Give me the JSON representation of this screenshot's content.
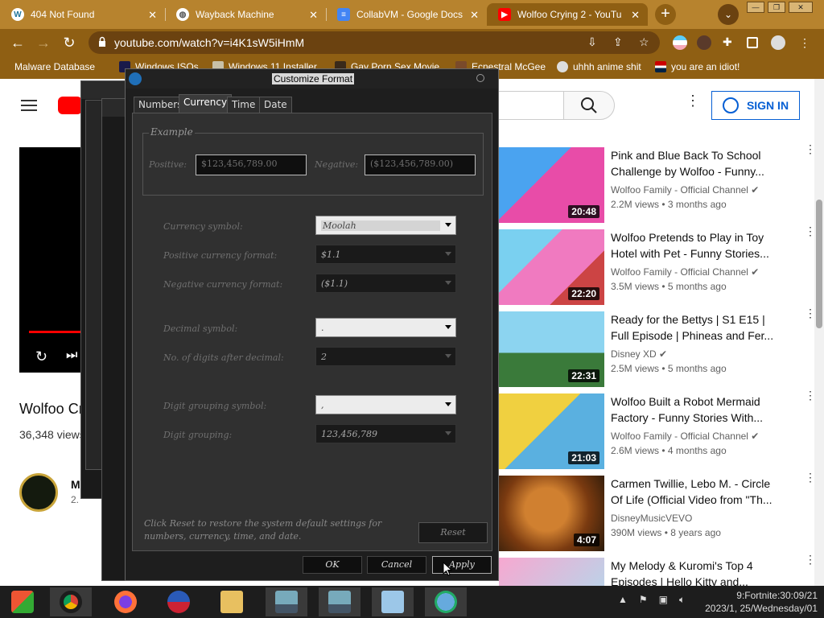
{
  "browser": {
    "tabs": [
      {
        "title": "404 Not Found",
        "icon": "wordpress-icon"
      },
      {
        "title": "Wayback Machine",
        "icon": "globe-icon"
      },
      {
        "title": "CollabVM - Google Docs",
        "icon": "google-docs-icon"
      },
      {
        "title": "Wolfoo Crying 2 - YouTu",
        "icon": "youtube-icon",
        "active": true
      }
    ],
    "url": "youtube.com/watch?v=i4K1sW5iHmM",
    "bookmarks": [
      {
        "label": "Malware Database"
      },
      {
        "label": "Windows ISOs"
      },
      {
        "label": "Windows 11 Installer"
      },
      {
        "label": "Gay Porn Sex Movie"
      },
      {
        "label": "Ecnestral McGee"
      },
      {
        "label": "uhhh anime shit"
      },
      {
        "label": "you are an idiot!"
      }
    ]
  },
  "youtube": {
    "sign_in": "SIGN IN",
    "video_title": "Wolfoo Cr",
    "views": "36,348 views",
    "channel_initial": "M",
    "subs": "2.",
    "recommendations": [
      {
        "title": "Pink and Blue Back To School Challenge by Wolfoo - Funny...",
        "channel": "Wolfoo Family - Official Channel",
        "views": "2.2M views",
        "age": "3 months ago",
        "duration": "20:48"
      },
      {
        "title": "Wolfoo Pretends to Play in Toy Hotel with Pet - Funny Stories...",
        "channel": "Wolfoo Family - Official Channel",
        "views": "3.5M views",
        "age": "5 months ago",
        "duration": "22:20"
      },
      {
        "title": "Ready for the Bettys | S1 E15 | Full Episode | Phineas and Fer...",
        "channel": "Disney XD",
        "views": "2.5M views",
        "age": "5 months ago",
        "duration": "22:31"
      },
      {
        "title": "Wolfoo Built a Robot Mermaid Factory - Funny Stories With...",
        "channel": "Wolfoo Family - Official Channel",
        "views": "2.6M views",
        "age": "4 months ago",
        "duration": "21:03"
      },
      {
        "title": "Carmen Twillie, Lebo M. - Circle Of Life (Official Video from \"Th...",
        "channel": "DisneyMusicVEVO",
        "views": "390M views",
        "age": "8 years ago",
        "duration": "4:07"
      },
      {
        "title": "My Melody & Kuromi's Top 4 Episodes | Hello Kitty and...",
        "channel": "",
        "views": "",
        "age": "",
        "duration": ""
      }
    ]
  },
  "dialog": {
    "title": "Customize Format",
    "tabs": [
      "Numbers",
      "Currency",
      "Time",
      "Date"
    ],
    "selected_tab": "Currency",
    "example_label": "Example",
    "positive_label": "Positive:",
    "positive_value": "$123,456,789.00",
    "negative_label": "Negative:",
    "negative_value": "($123,456,789.00)",
    "fields": [
      {
        "label": "Currency symbol:",
        "value": "Moolah"
      },
      {
        "label": "Positive currency format:",
        "value": "$1.1"
      },
      {
        "label": "Negative currency format:",
        "value": "($1.1)"
      },
      {
        "label": "Decimal symbol:",
        "value": "."
      },
      {
        "label": "No. of digits after decimal:",
        "value": "2"
      },
      {
        "label": "Digit grouping symbol:",
        "value": ","
      },
      {
        "label": "Digit grouping:",
        "value": "123,456,789"
      }
    ],
    "reset_message": "Click Reset to restore the system default settings for numbers, currency, time, and date.",
    "reset_button": "Reset",
    "ok_button": "OK",
    "cancel_button": "Cancel",
    "apply_button": "Apply"
  },
  "taskbar": {
    "clock_line1": "9:Fortnite:30:09/21",
    "clock_line2": "2023/1, 25/Wednesday/01"
  }
}
